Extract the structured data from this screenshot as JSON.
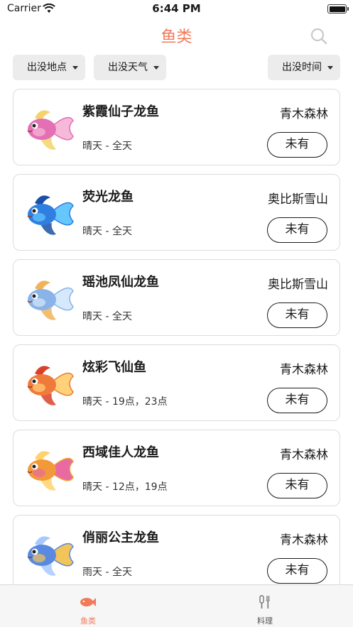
{
  "status_bar": {
    "carrier": "Carrier",
    "time": "6:44 PM"
  },
  "nav": {
    "title": "鱼类",
    "search_icon": "search-icon"
  },
  "filters": {
    "location": "出没地点",
    "weather": "出没天气",
    "time": "出没时间"
  },
  "fish": [
    {
      "name": "紫霞仙子龙鱼",
      "weather": "晴天 - 全天",
      "location": "青木森林",
      "status": "未有",
      "colors": [
        "#e46fb5",
        "#f6b9d9",
        "#f4d36a"
      ]
    },
    {
      "name": "荧光龙鱼",
      "weather": "晴天 - 全天",
      "location": "奥比斯雪山",
      "status": "未有",
      "colors": [
        "#2f7fe0",
        "#66c7ff",
        "#1c4fa8"
      ]
    },
    {
      "name": "瑶池凤仙龙鱼",
      "weather": "晴天 - 全天",
      "location": "奥比斯雪山",
      "status": "未有",
      "colors": [
        "#8ab4e8",
        "#d6e8fb",
        "#f0b35a"
      ]
    },
    {
      "name": "炫彩飞仙鱼",
      "weather": "晴天 - 19点，23点",
      "location": "青木森林",
      "status": "未有",
      "colors": [
        "#f07a3a",
        "#ffd27a",
        "#d9422a"
      ]
    },
    {
      "name": "西域佳人龙鱼",
      "weather": "晴天 - 12点，19点",
      "location": "青木森林",
      "status": "未有",
      "colors": [
        "#f29a3a",
        "#e86aa0",
        "#ffd36a"
      ]
    },
    {
      "name": "俏丽公主龙鱼",
      "weather": "雨天 - 全天",
      "location": "青木森林",
      "status": "未有",
      "colors": [
        "#5a8ae0",
        "#f2c45a",
        "#a7c9ff"
      ]
    }
  ],
  "tabs": [
    {
      "label": "鱼类",
      "icon": "fish-icon",
      "active": true
    },
    {
      "label": "料理",
      "icon": "cooking-icon",
      "active": false
    }
  ],
  "theme": {
    "accent": "#f07a5a"
  }
}
